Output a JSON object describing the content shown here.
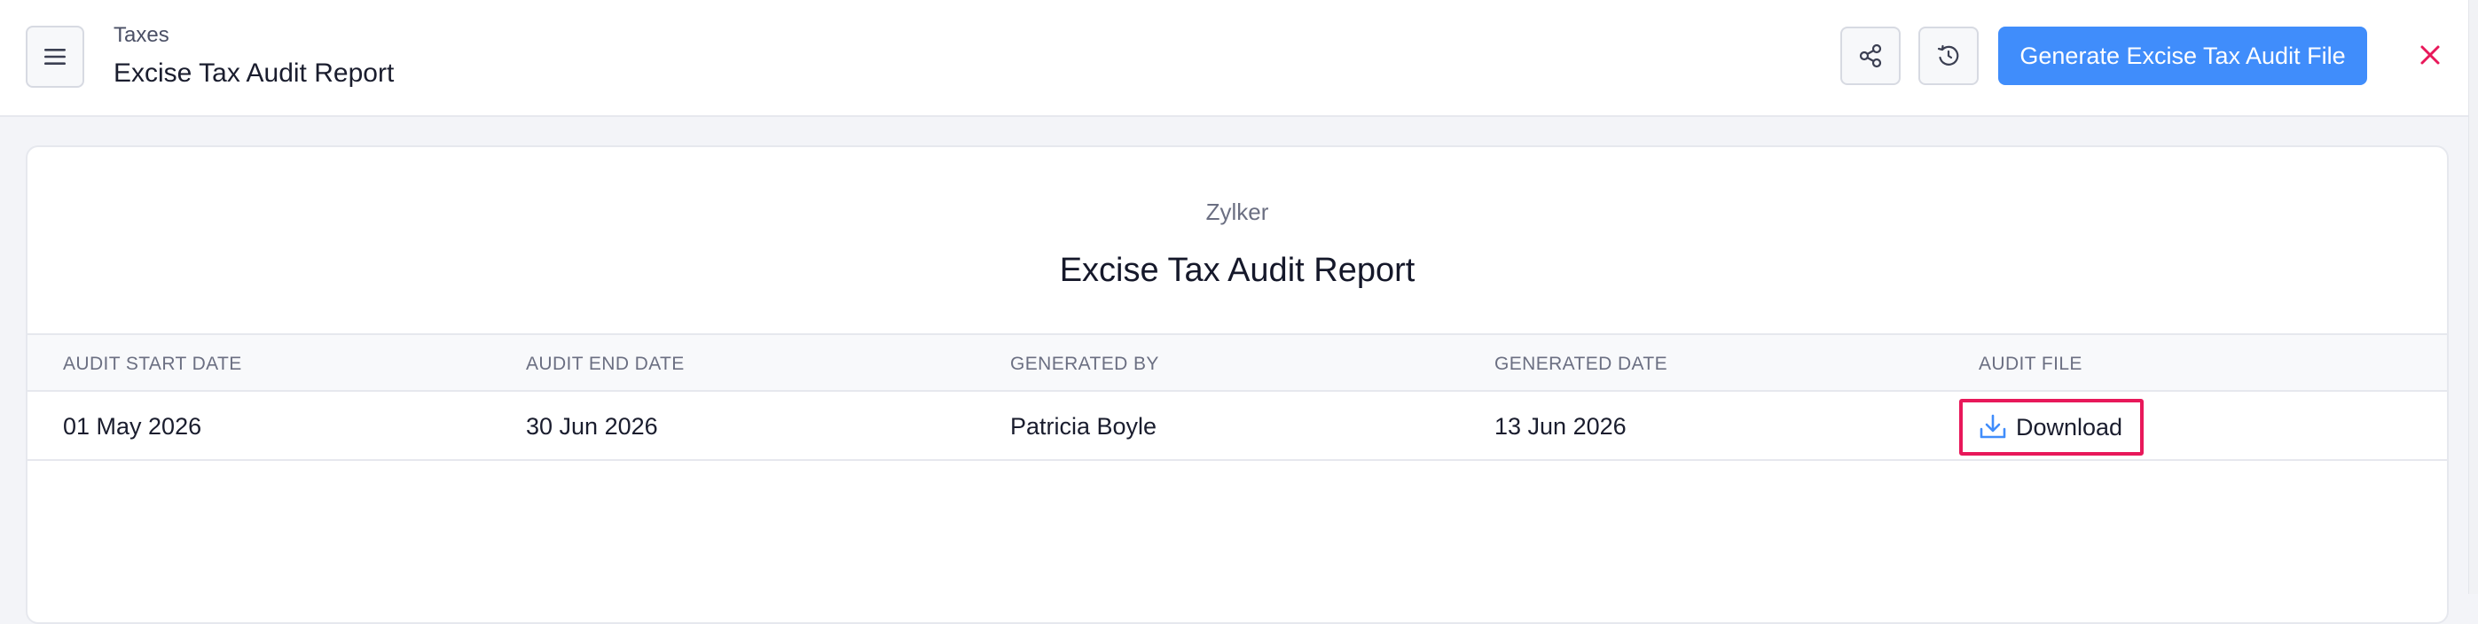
{
  "header": {
    "breadcrumb": "Taxes",
    "title": "Excise Tax Audit Report",
    "generate_label": "Generate Excise Tax Audit File",
    "icons": {
      "menu": "hamburger-menu-icon",
      "share": "share-icon",
      "history": "history-icon",
      "close": "close-icon"
    }
  },
  "report": {
    "organization": "Zylker",
    "title": "Excise Tax Audit Report",
    "columns": [
      "AUDIT START DATE",
      "AUDIT END DATE",
      "GENERATED BY",
      "GENERATED DATE",
      "AUDIT FILE"
    ],
    "rows": [
      {
        "audit_start_date": "01 May 2026",
        "audit_end_date": "30 Jun 2026",
        "generated_by": "Patricia Boyle",
        "generated_date": "13 Jun 2026",
        "audit_file_label": "Download"
      }
    ]
  },
  "colors": {
    "accent": "#408dfb",
    "close": "#e8185a",
    "highlight_border": "#e8185a",
    "download_icon": "#408dfb"
  }
}
